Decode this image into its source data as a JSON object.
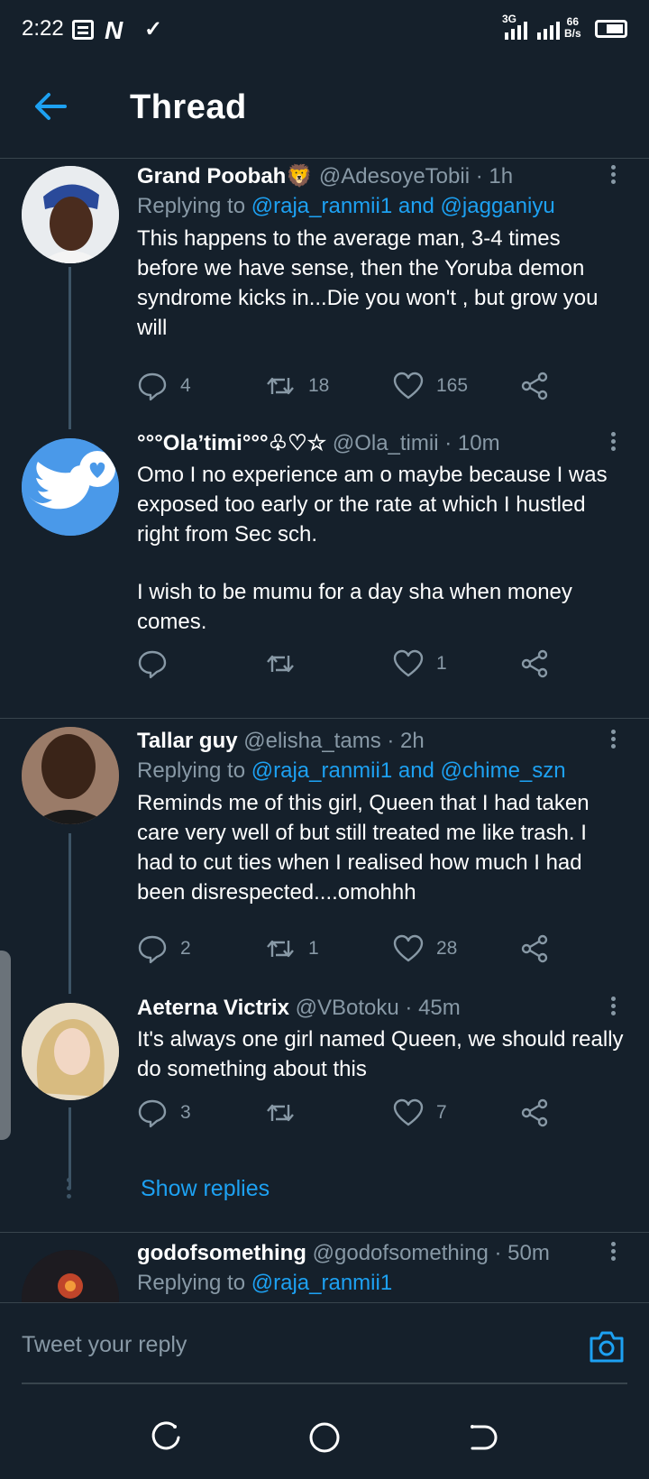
{
  "status_bar": {
    "time": "2:22",
    "network": "3G",
    "speed_value": "66",
    "speed_unit": "B/s"
  },
  "header": {
    "title": "Thread"
  },
  "tweets": [
    {
      "name": "Grand Poobah",
      "name_emoji": "🦁",
      "handle": "@AdesoyeTobii",
      "time": "· 1h",
      "replying_prefix": "Replying to ",
      "replying_to": "@raja_ranmii1 and @jagganiyu",
      "text": "This happens to the average man, 3-4 times before we have sense, then the Yoruba demon syndrome kicks in...Die you won't , but grow you will",
      "replies": "4",
      "retweets": "18",
      "likes": "165"
    },
    {
      "name": "°°°Ola’timi°°°♧♡☆",
      "handle": "@Ola_timii",
      "time": "· 10m",
      "text": "Omo I no experience am o maybe because I was exposed too early or the rate at which I hustled right from Sec sch.",
      "text2": "I wish to be mumu for a day sha when money comes.",
      "replies": "",
      "retweets": "",
      "likes": "1"
    },
    {
      "name": "Tallar guy",
      "handle": "@elisha_tams",
      "time": "· 2h",
      "replying_prefix": "Replying to ",
      "replying_to": "@raja_ranmii1 and @chime_szn",
      "text": "Reminds me of this girl, Queen that I had taken care very well of but still treated me like trash. I had to cut ties when I realised how much I had been disrespected....omohhh",
      "replies": "2",
      "retweets": "1",
      "likes": "28"
    },
    {
      "name": "Aeterna Victrix",
      "handle": "@VBotoku",
      "time": "· 45m",
      "text": "It's always one girl named Queen, we should really do something about this",
      "replies": "3",
      "retweets": "",
      "likes": "7"
    },
    {
      "name": "godofsomething",
      "handle": "@godofsomething",
      "time": "· 50m",
      "replying_prefix": "Replying to ",
      "replying_to": "@raja_ranmii1"
    }
  ],
  "show_replies": "Show replies",
  "reply_bar": {
    "placeholder": "Tweet your reply"
  },
  "colors": {
    "background": "#15202b",
    "accent": "#1da1f2",
    "muted": "#8899a6",
    "divider": "#38444d"
  }
}
